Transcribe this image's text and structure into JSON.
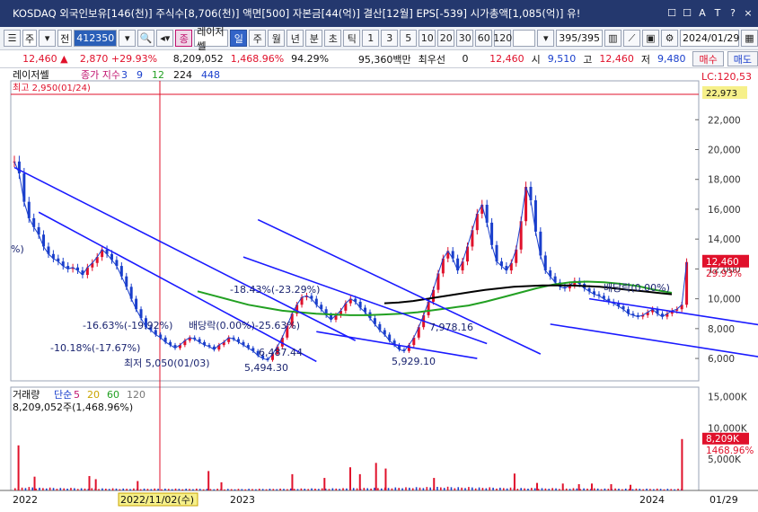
{
  "titlebar": {
    "text": "KOSDAQ 외국인보유[146(천)] 주식수[8,706(천)] 액면[500] 자본금[44(억)] 결산[12월] EPS[-539] 시가총액[1,085(억)] 유!",
    "buttons": [
      "☐",
      "☐",
      "A",
      "T",
      "?"
    ],
    "close": "×"
  },
  "toolbar": {
    "code_type": "주",
    "jeon": "전",
    "code": "412350",
    "name_tag": "종",
    "stock_name": "레이저쎌",
    "periods": [
      "일",
      "주",
      "월",
      "년",
      "분",
      "초",
      "틱"
    ],
    "active_period": "일",
    "intervals": [
      "1",
      "3",
      "5",
      "10",
      "20",
      "30",
      "60",
      "120"
    ],
    "count": "395/395",
    "date": "2024/01/29"
  },
  "quote": {
    "price": "12,460",
    "change": "2,870",
    "change_pct": "+29.93%",
    "volume": "8,209,052",
    "vol_ratio": "1,468.96%",
    "ratio2": "94.29%",
    "amount": "95,360백만",
    "priority_label": "최우선",
    "priority_value": "0",
    "bid_price": "12,460",
    "open_label": "시",
    "open": "9,510",
    "high_label": "고",
    "high": "12,460",
    "low_label": "저",
    "low": "9,480",
    "buy_button": "매수",
    "sell_button": "매도"
  },
  "colors": {
    "up": "#e0112b",
    "down": "#1a3fcc",
    "ma5": "#1a3fcc",
    "ma60": "#22a022",
    "ma120": "#000000",
    "titlebar": "#24386e"
  },
  "chart_data": [
    {
      "type": "candlestick",
      "title": "레이저쎌",
      "legend": [
        "종가 지수",
        "3",
        "9",
        "12",
        "224",
        "448"
      ],
      "lc_label": "LC:120,53",
      "top_line_label": "최고 2,950(01/24)",
      "right_badge": "22,973",
      "ylim": [
        4500,
        23400
      ],
      "yticks": [
        6000,
        8000,
        10000,
        12000,
        14000,
        16000,
        18000,
        20000,
        22000
      ],
      "ytick_labels": [
        "6,000",
        "8,000",
        "10,000",
        "12,000",
        "14,000",
        "16,000",
        "18,000",
        "20,000",
        "22,000"
      ],
      "current_price": "12,460",
      "current_pct": "29.93%",
      "x_labels": [
        "2022",
        "2022/11/02(수)",
        "2023",
        "2024",
        "01/29"
      ],
      "annotations": [
        "-18.43%(-23.29%)",
        "7,978.16",
        "-16.63%(-19.92%)",
        "배당락(0.00%)-25.63%)",
        "-10.18%(-17.67%)",
        "6,487.44",
        "최저 5,050(01/03)",
        "5,494.30",
        "5,929.10",
        "배당락(0.00%)",
        "%)"
      ],
      "price_series": [
        19200,
        18400,
        16500,
        15400,
        14800,
        14300,
        13500,
        13000,
        12700,
        12500,
        12200,
        12000,
        12100,
        11900,
        11600,
        12100,
        12400,
        12800,
        13300,
        13000,
        12600,
        12200,
        11500,
        10800,
        10000,
        9300,
        8700,
        8100,
        7900,
        7600,
        7400,
        7100,
        6900,
        6700,
        6900,
        7200,
        7400,
        7300,
        7100,
        6900,
        6800,
        6600,
        6900,
        7100,
        7400,
        7300,
        7100,
        6900,
        6700,
        6500,
        6200,
        6000,
        5900,
        6300,
        6800,
        7400,
        8200,
        9000,
        9600,
        10100,
        10200,
        10000,
        9600,
        9300,
        8900,
        8600,
        8900,
        9200,
        9700,
        10000,
        9800,
        9400,
        9100,
        8700,
        8300,
        7900,
        7600,
        7200,
        6900,
        6600,
        6500,
        6900,
        7400,
        8100,
        8900,
        9800,
        10600,
        11700,
        12700,
        13200,
        12700,
        11900,
        12500,
        13500,
        14600,
        15700,
        16300,
        15100,
        13600,
        12500,
        12200,
        11900,
        12400,
        13300,
        15200,
        17500,
        16600,
        14500,
        12900,
        11900,
        11500,
        11100,
        10800,
        10700,
        10900,
        11200,
        11000,
        10700,
        10500,
        10300,
        10200,
        10000,
        9800,
        9700,
        9500,
        9300,
        9000,
        8900,
        8800,
        8900,
        9100,
        9300,
        9000,
        8800,
        9000,
        9200,
        9300,
        9600,
        12460
      ],
      "ma60": [
        10500,
        10200,
        9900,
        9600,
        9400,
        9200,
        9100,
        9000,
        8950,
        8900,
        8900,
        8950,
        9000,
        9100,
        9250,
        9400,
        9550,
        9800,
        10100,
        10400,
        10700,
        10950,
        11100,
        11150,
        11100,
        11000,
        10850,
        10600,
        10400
      ],
      "ma120": [
        9700,
        9750,
        9850,
        10000,
        10150,
        10300,
        10450,
        10600,
        10700,
        10800,
        10850,
        10900,
        10900,
        10900,
        10850,
        10800,
        10700,
        10600,
        10500,
        10400,
        10300
      ],
      "channels": [
        {
          "from": [
            0,
            18800
          ],
          "to": [
            70,
            7200
          ]
        },
        {
          "from": [
            5,
            15800
          ],
          "to": [
            62,
            5800
          ]
        },
        {
          "from": [
            50,
            15300
          ],
          "to": [
            108,
            6300
          ]
        },
        {
          "from": [
            47,
            12800
          ],
          "to": [
            97,
            7000
          ]
        },
        {
          "from": [
            62,
            7800
          ],
          "to": [
            95,
            6000
          ]
        },
        {
          "from": [
            118,
            10000
          ],
          "to": [
            160,
            7900
          ]
        },
        {
          "from": [
            110,
            8300
          ],
          "to": [
            157,
            5900
          ]
        }
      ]
    },
    {
      "type": "bar",
      "title": "거래량",
      "legend": [
        "단순",
        "5",
        "20",
        "60",
        "120"
      ],
      "volume_label": "8,209,052주(1,468.96%)",
      "ylim": [
        0,
        16500000
      ],
      "yticks": [
        5000000,
        10000000,
        15000000
      ],
      "ytick_labels": [
        "5,000K",
        "10,000K",
        "15,000K"
      ],
      "current_volume": "8,209K",
      "current_pct": "1468.96%",
      "spikes": [
        [
          1,
          7200000
        ],
        [
          6,
          2200000
        ],
        [
          23,
          2300000
        ],
        [
          25,
          1800000
        ],
        [
          38,
          1500000
        ],
        [
          60,
          3100000
        ],
        [
          64,
          1300000
        ],
        [
          86,
          2600000
        ],
        [
          96,
          2000000
        ],
        [
          104,
          3700000
        ],
        [
          107,
          2600000
        ],
        [
          112,
          4400000
        ],
        [
          115,
          3500000
        ],
        [
          130,
          2000000
        ],
        [
          155,
          2700000
        ],
        [
          162,
          1200000
        ],
        [
          170,
          1100000
        ],
        [
          175,
          1000000
        ],
        [
          179,
          1100000
        ],
        [
          185,
          1000000
        ],
        [
          191,
          900000
        ],
        [
          207,
          8209052
        ]
      ],
      "base": [
        600000,
        500000,
        450000,
        400000,
        380000,
        350000,
        340000,
        330000,
        320000,
        300000,
        280000,
        300000,
        320000,
        350000,
        380000,
        400000,
        450000,
        500000,
        550000,
        600000,
        650000,
        600000,
        550000,
        500000,
        450000,
        420000,
        400000,
        380000,
        350000,
        330000,
        320000,
        300000
      ]
    }
  ]
}
